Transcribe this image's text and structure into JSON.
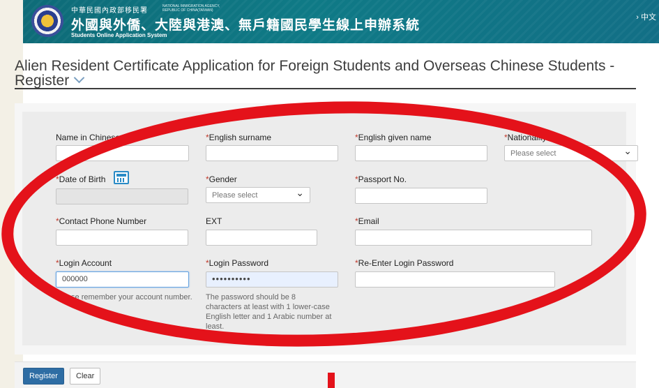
{
  "header": {
    "agency_zh": "中華民國內政部移民署",
    "agency_en_1": "NATIONAL IMMIGRATION AGENCY,",
    "agency_en_2": "REPUBLIC OF CHINA(TAIWAN)",
    "system_title": "外國與外僑、大陸與港澳、無戶籍國民學生線上申辦系統",
    "system_subtitle": "Students Online Application System",
    "language_link": "› 中文"
  },
  "page_title": "Alien Resident Certificate Application for Foreign Students and Overseas Chinese Students - Register",
  "form": {
    "required_mark": "*",
    "name_chinese": {
      "label": "Name in Chinese",
      "value": ""
    },
    "english_surname": {
      "label": "English surname",
      "value": ""
    },
    "english_given_name": {
      "label": "English given name",
      "value": ""
    },
    "nationality": {
      "label": "Nationality",
      "selected": "Please select"
    },
    "date_of_birth": {
      "label": "Date of Birth",
      "value": ""
    },
    "gender": {
      "label": "Gender",
      "selected": "Please select"
    },
    "passport_no": {
      "label": "Passport No.",
      "value": ""
    },
    "contact_phone": {
      "label": "Contact Phone Number",
      "value": ""
    },
    "ext": {
      "label": "EXT",
      "value": ""
    },
    "email": {
      "label": "Email",
      "value": ""
    },
    "login_account": {
      "label": "Login Account",
      "value": "000000",
      "help": "Please remember your account number."
    },
    "login_password": {
      "label": "Login Password",
      "value": "••••••••••",
      "help": "The password should be 8 characters at least with 1 lower-case English letter and 1 Arabic number at least."
    },
    "reenter_password": {
      "label": "Re-Enter Login Password",
      "value": ""
    }
  },
  "buttons": {
    "register": "Register",
    "clear": "Clear"
  },
  "colors": {
    "header_teal": "#0f7a86",
    "required_red": "#c0392b",
    "annotation_red": "#e4121a",
    "primary_blue": "#2e6da4"
  },
  "icons": {
    "calendar": "calendar-icon",
    "emblem": "agency-emblem-icon"
  }
}
